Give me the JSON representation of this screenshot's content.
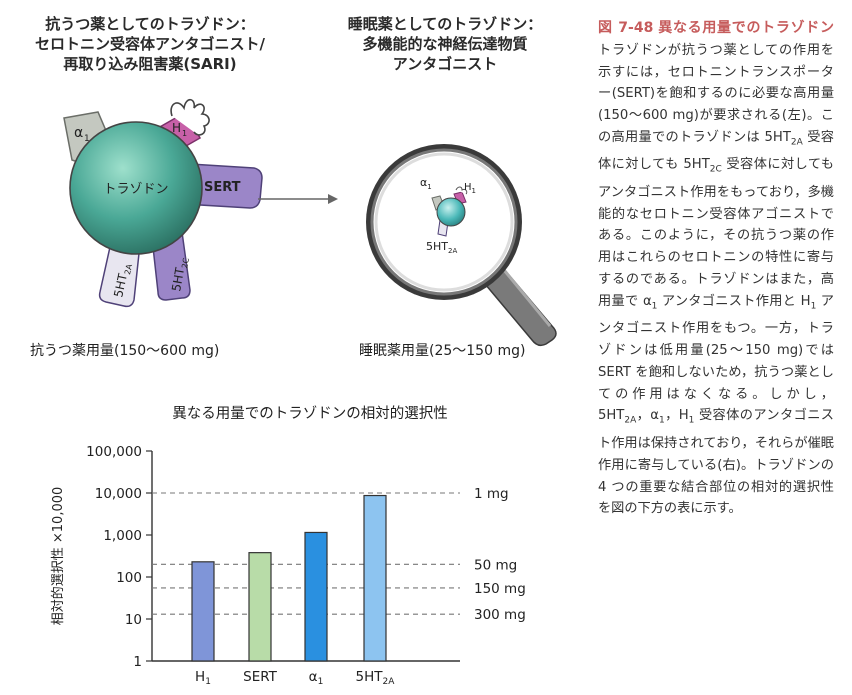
{
  "left_panel": {
    "title_line1": "抗うつ薬としてのトラゾドン：",
    "title_line2": "セロトニン受容体アンタゴニスト/",
    "title_line3": "再取り込み阻害薬(SARI)",
    "molecule_label": "トラゾドン",
    "receptor_alpha1": "α",
    "receptor_alpha1_sub": "1",
    "receptor_h1": "H",
    "receptor_h1_sub": "1",
    "receptor_sert": "SERT",
    "receptor_5ht2a": "5HT",
    "receptor_5ht2a_sub": "2A",
    "receptor_5ht2c": "5HT",
    "receptor_5ht2c_sub": "2C",
    "dose_label": "抗うつ薬用量(150～600 mg)"
  },
  "right_panel": {
    "title_line1": "睡眠薬としてのトラゾドン：",
    "title_line2": "多機能的な神経伝達物質",
    "title_line3": "アンタゴニスト",
    "receptor_alpha1": "α",
    "receptor_alpha1_sub": "1",
    "receptor_h1": "H",
    "receptor_h1_sub": "1",
    "receptor_5ht2a": "5HT",
    "receptor_5ht2a_sub": "2A",
    "dose_label": "睡眠薬用量(25～150 mg)"
  },
  "caption": {
    "fig_number": "図 7-48",
    "fig_title": "異なる用量でのトラゾドン",
    "p1": "トラゾドンが抗うつ薬としての作用を示すには，セロトニントランスポーター(SERT)を飽和するのに必要な高用量(150～600 mg)が要求される(左)。この高用量でのトラゾドンは 5HT",
    "p1_sub": "2A",
    "p2": " 受容体に対しても 5HT",
    "p2_sub": "2C",
    "p3": " 受容体に対してもアンタゴニスト作用をもっており，多機能的なセロトニン受容体アゴニストである。このように，その抗うつ薬の作用はこれらのセロトニンの特性に寄与するのである。トラゾドンはまた，高用量で α",
    "p3_sub": "1",
    "p4": " アンタゴニスト作用と H",
    "p4_sub": "1",
    "p5": " アンタゴニスト作用をもつ。一方，トラゾドンは低用量(25～150 mg)では SERT を飽和しないため，抗うつ薬としての作用はなくなる。しかし，5HT",
    "p5_sub": "2A",
    "p6": "，α",
    "p6_sub": "1",
    "p7": "，H",
    "p7_sub": "1",
    "p8": " 受容体のアンタゴニスト作用は保持されており，それらが催眠作用に寄与している(右)。トラゾドンの 4 つの重要な結合部位の相対的選択性を図の下方の表に示す。"
  },
  "chart_data": {
    "type": "bar",
    "title": "異なる用量でのトラゾドンの相対的選択性",
    "ylabel": "相対的選択性 ×10,000",
    "xlabel": "",
    "yscale": "log",
    "ylim": [
      1,
      100000
    ],
    "yticks": [
      "100,000",
      "10,000",
      "1,000",
      "100",
      "10",
      "1"
    ],
    "ytick_values": [
      100000,
      10000,
      1000,
      100,
      10,
      1
    ],
    "categories": [
      "H1",
      "SERT",
      "α1",
      "5HT2A"
    ],
    "category_main": [
      "H",
      "SERT",
      "α",
      "5HT"
    ],
    "category_sub": [
      "1",
      "",
      "1",
      "2A"
    ],
    "values": [
      230,
      380,
      1150,
      8700
    ],
    "bar_colors": [
      "#7f95d8",
      "#b8dca8",
      "#2a90e0",
      "#8dc4f0"
    ],
    "dose_lines": [
      {
        "label": "1 mg",
        "value": 10000
      },
      {
        "label": "50 mg",
        "value": 200
      },
      {
        "label": "150 mg",
        "value": 55
      },
      {
        "label": "300 mg",
        "value": 13
      }
    ],
    "grid": false
  }
}
